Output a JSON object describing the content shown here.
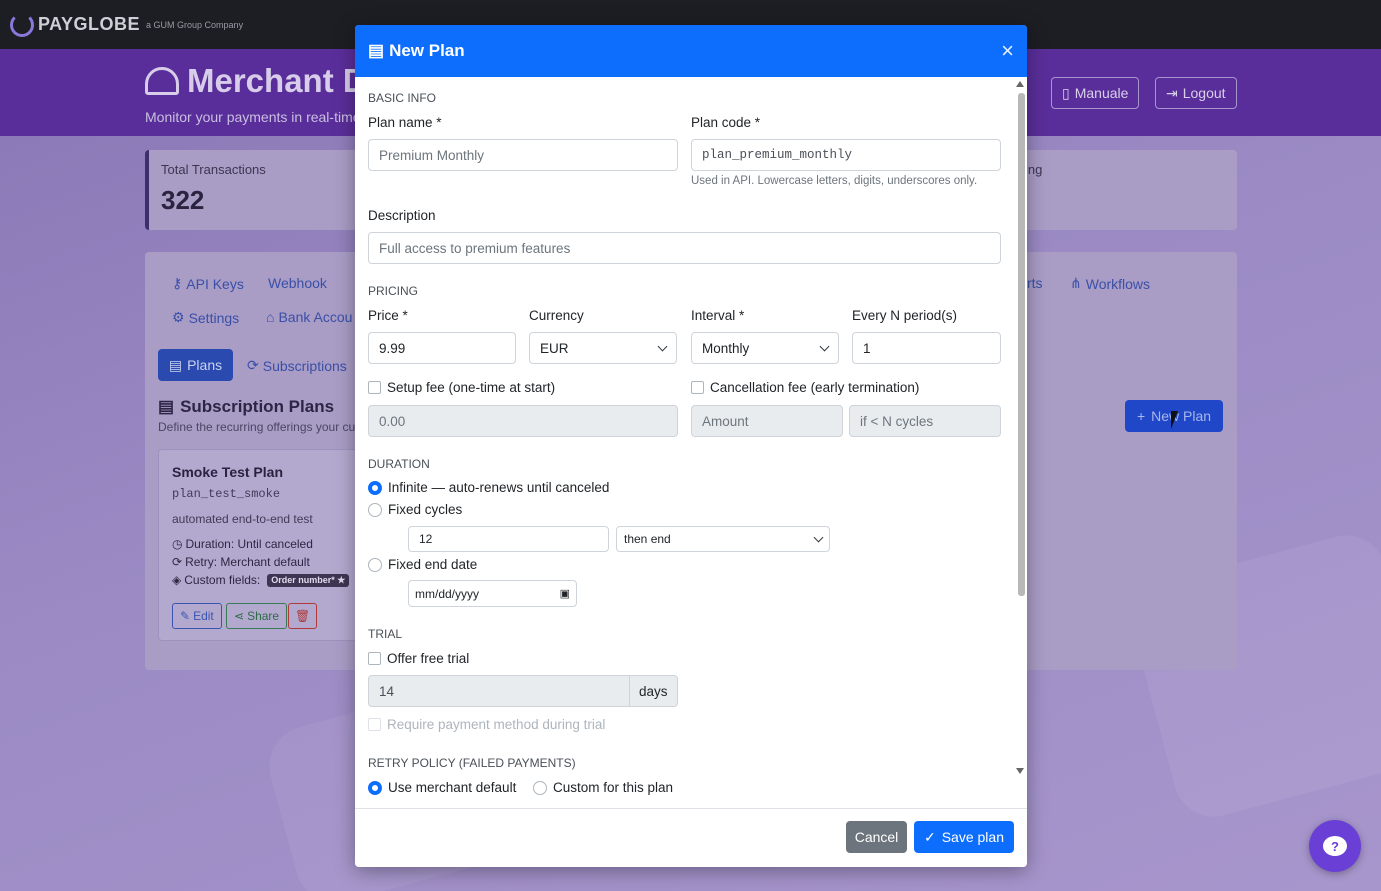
{
  "app": {
    "brand": "PAYGLOBE",
    "brand_sub": "a GUM Group Company"
  },
  "hero": {
    "title": "Merchant D",
    "subtitle": "Monitor your payments in real-time",
    "buttons": [
      "Manuale",
      "Logout"
    ]
  },
  "stats": {
    "label": "Total Transactions",
    "value": "322",
    "right_label": "ing"
  },
  "nav": {
    "row1": [
      "API Keys",
      "Webhook",
      "rts",
      "Workflows"
    ],
    "row2": [
      "Settings",
      "Bank Accou"
    ]
  },
  "subtabs": {
    "plans": "Plans",
    "subscriptions": "Subscriptions"
  },
  "section": {
    "title": "Subscription Plans",
    "subtitle": "Define the recurring offerings your cu",
    "new_plan": "New Plan"
  },
  "plan_card": {
    "title": "Smoke Test Plan",
    "code": "plan_test_smoke",
    "description": "automated end-to-end test",
    "duration": "Duration: Until canceled",
    "retry": "Retry: Merchant default",
    "custom_fields": "Custom fields:",
    "badge": "Order number* ★",
    "edit": "Edit",
    "share": "Share"
  },
  "modal": {
    "title": "New Plan",
    "close": "×",
    "basic_info": "BASIC INFO",
    "plan_name_label": "Plan name *",
    "plan_name_placeholder": "Premium Monthly",
    "plan_code_label": "Plan code *",
    "plan_code_placeholder": "plan_premium_monthly",
    "plan_code_help": "Used in API. Lowercase letters, digits, underscores only.",
    "description_label": "Description",
    "description_placeholder": "Full access to premium features",
    "pricing": "PRICING",
    "price_label": "Price *",
    "price_value": "9.99",
    "currency_label": "Currency",
    "currency_value": "EUR",
    "interval_label": "Interval *",
    "interval_value": "Monthly",
    "every_label": "Every N period(s)",
    "every_value": "1",
    "setup_fee_label": "Setup fee (one-time at start)",
    "setup_fee_placeholder": "0.00",
    "cancel_fee_label": "Cancellation fee (early termination)",
    "amount_placeholder": "Amount",
    "cycles_placeholder": "if < N cycles",
    "duration": "DURATION",
    "dur_infinite": "Infinite — auto-renews until canceled",
    "dur_fixed_cycles": "Fixed cycles",
    "cycles_value": "12",
    "then_value": "then end",
    "dur_fixed_date": "Fixed end date",
    "date_placeholder": "mm/dd/yyyy",
    "trial": "TRIAL",
    "offer_trial": "Offer free trial",
    "trial_days": "14",
    "days": "days",
    "require_payment": "Require payment method during trial",
    "retry_policy": "RETRY POLICY (FAILED PAYMENTS)",
    "retry_default": "Use merchant default",
    "retry_custom": "Custom for this plan",
    "cancel": "Cancel",
    "save": "Save plan"
  },
  "colors": {
    "primary": "#0d6efd",
    "secondary": "#6c757d",
    "header_dark": "#1d1d24",
    "hero": "#5a2e9a"
  },
  "icons": [
    "list-icon",
    "close-icon",
    "check-icon",
    "chevron-down-icon",
    "calendar-icon",
    "chat-icon",
    "gauge-icon",
    "key-icon",
    "gear-icon",
    "bank-icon",
    "workflow-icon",
    "book-icon",
    "logout-icon",
    "refresh-icon",
    "plus-icon",
    "pencil-icon",
    "share-icon",
    "trash-icon",
    "clock-icon"
  ]
}
